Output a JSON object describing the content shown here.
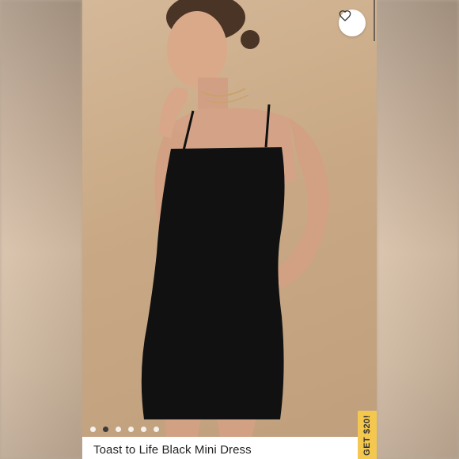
{
  "listing": {
    "title": "Toast to Life Black Mini Dress",
    "image_count": 6,
    "active_image": 2
  },
  "promo": {
    "label": "GET $20!"
  },
  "icons": {
    "like": "heart-icon"
  },
  "colors": {
    "promo": "#f4c84f",
    "background": "#c9a985",
    "dress": "#111111"
  }
}
